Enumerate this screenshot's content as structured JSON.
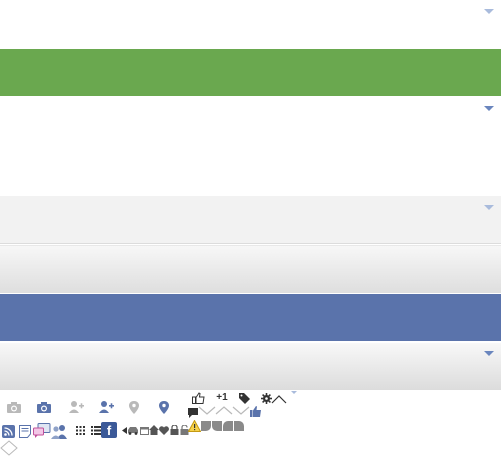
{
  "colors": {
    "green_band": "#6aa84f",
    "blue_band": "#5a73ab",
    "caret": "#6a86be",
    "light_band": "#f2f2f2"
  },
  "icons": [
    "camera-icon",
    "camera-icon",
    "add-friend-icon",
    "add-friend-icon",
    "location-pin-icon",
    "location-pin-icon",
    "like-icon",
    "plus-one-icon",
    "tag-icon",
    "gear-icon",
    "chevron-up-icon",
    "comment-icon",
    "chevron-down-icon",
    "thumbs-up-icon",
    "rss-icon",
    "note-icon",
    "chat-icon",
    "friends-icon",
    "grid-icon",
    "list-icon",
    "facebook-icon",
    "warning-icon",
    "lock-icon",
    "heart-icon",
    "home-icon",
    "diamond-icon"
  ],
  "sprite_labels": {
    "plus_one": "+1",
    "facebook": "f"
  }
}
